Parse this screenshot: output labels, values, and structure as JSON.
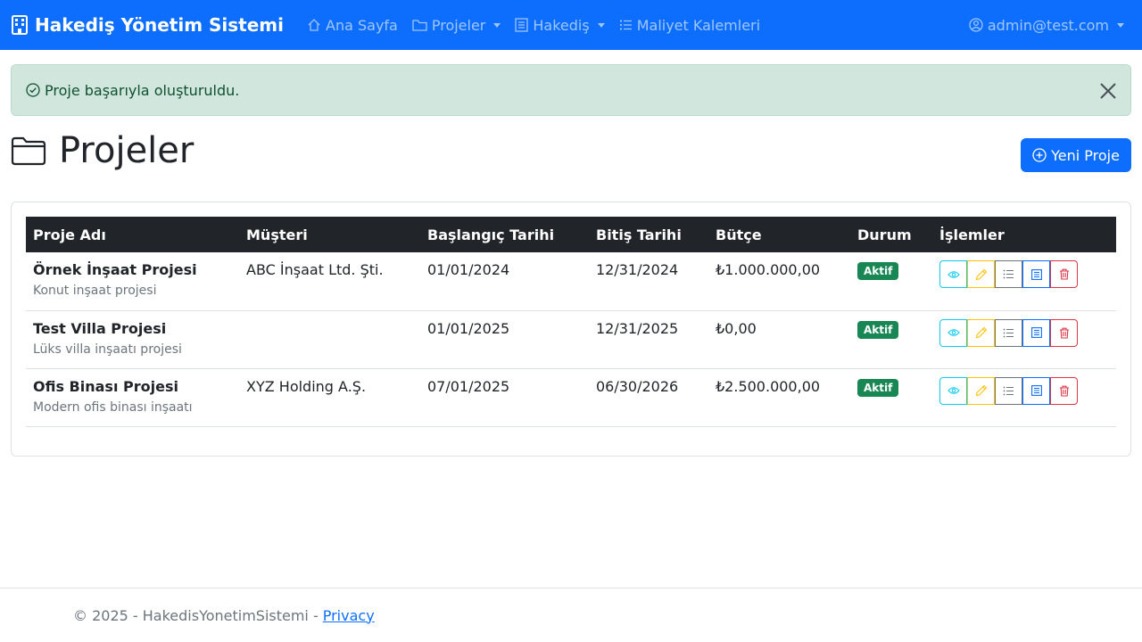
{
  "navbar": {
    "brand": "Hakediş Yönetim Sistemi",
    "items": [
      {
        "label": "Ana Sayfa",
        "icon": "house-icon",
        "dropdown": false
      },
      {
        "label": "Projeler",
        "icon": "folder-icon",
        "dropdown": true
      },
      {
        "label": "Hakediş",
        "icon": "receipt-icon",
        "dropdown": true
      },
      {
        "label": "Maliyet Kalemleri",
        "icon": "list-icon",
        "dropdown": false
      }
    ],
    "user": "admin@test.com"
  },
  "alert": {
    "message": "Proje başarıyla oluşturuldu."
  },
  "page": {
    "title": "Projeler",
    "new_button": "Yeni Proje"
  },
  "table": {
    "headers": [
      "Proje Adı",
      "Müşteri",
      "Başlangıç Tarihi",
      "Bitiş Tarihi",
      "Bütçe",
      "Durum",
      "İşlemler"
    ],
    "rows": [
      {
        "name": "Örnek İnşaat Projesi",
        "desc": "Konut inşaat projesi",
        "customer": "ABC İnşaat Ltd. Şti.",
        "start": "01/01/2024",
        "end": "12/31/2024",
        "budget": "₺1.000.000,00",
        "status": "Aktif"
      },
      {
        "name": "Test Villa Projesi",
        "desc": "Lüks villa inşaatı projesi",
        "customer": "",
        "start": "01/01/2025",
        "end": "12/31/2025",
        "budget": "₺0,00",
        "status": "Aktif"
      },
      {
        "name": "Ofis Binası Projesi",
        "desc": "Modern ofis binası inşaatı",
        "customer": "XYZ Holding A.Ş.",
        "start": "07/01/2025",
        "end": "06/30/2026",
        "budget": "₺2.500.000,00",
        "status": "Aktif"
      }
    ]
  },
  "footer": {
    "text": "© 2025 - HakedisYonetimSistemi -",
    "link": "Privacy"
  },
  "colors": {
    "primary": "#0d6efd",
    "success": "#198754",
    "info": "#0dcaf0",
    "warning": "#ffc107",
    "danger": "#dc3545",
    "dark": "#212529"
  }
}
